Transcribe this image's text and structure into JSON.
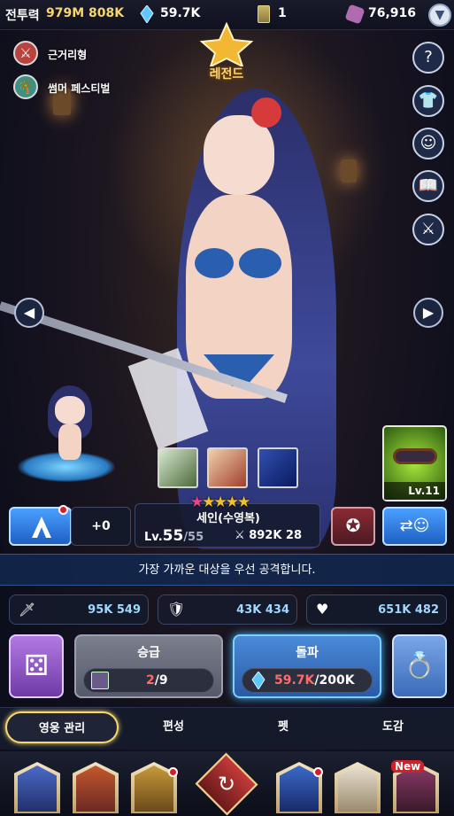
{
  "topbar": {
    "combat_power_label": "전투력",
    "combat_power_value": "979M 808K",
    "gem_value": "59.7K",
    "ticket_value": "1",
    "dice_value": "76,916"
  },
  "hero": {
    "rank_label": "레전드",
    "tags": [
      "근거리형",
      "썸머 페스티벌"
    ],
    "name": "세인(수영복)",
    "level_prefix": "Lv.",
    "level": "55",
    "level_max": "/55",
    "power": "892K 28",
    "stars": 5,
    "equipment_level": "Lv.11",
    "skill_plus": "+0",
    "description": "가장 가까운 대상을 우선 공격합니다."
  },
  "stats": {
    "attack": "95K 549",
    "defense": "43K 434",
    "hp": "651K 482"
  },
  "actions": {
    "promote_label": "승급",
    "promote_value": "2",
    "promote_max": "/9",
    "breakthrough_label": "돌파",
    "breakthrough_value": "59.7K",
    "breakthrough_max": "/200K"
  },
  "tabs": [
    "영웅 관리",
    "편성",
    "펫",
    "도감"
  ],
  "bottom_nav": {
    "new_badge": "New"
  },
  "icons": {
    "side": [
      "help-icon",
      "costume-icon",
      "profile-icon",
      "book-icon",
      "crossed-swords-icon"
    ]
  },
  "colors": {
    "accent_blue": "#46b8ff",
    "gold": "#f5d76e",
    "star": "#f0c12a",
    "star_pink": "#e8458a"
  }
}
